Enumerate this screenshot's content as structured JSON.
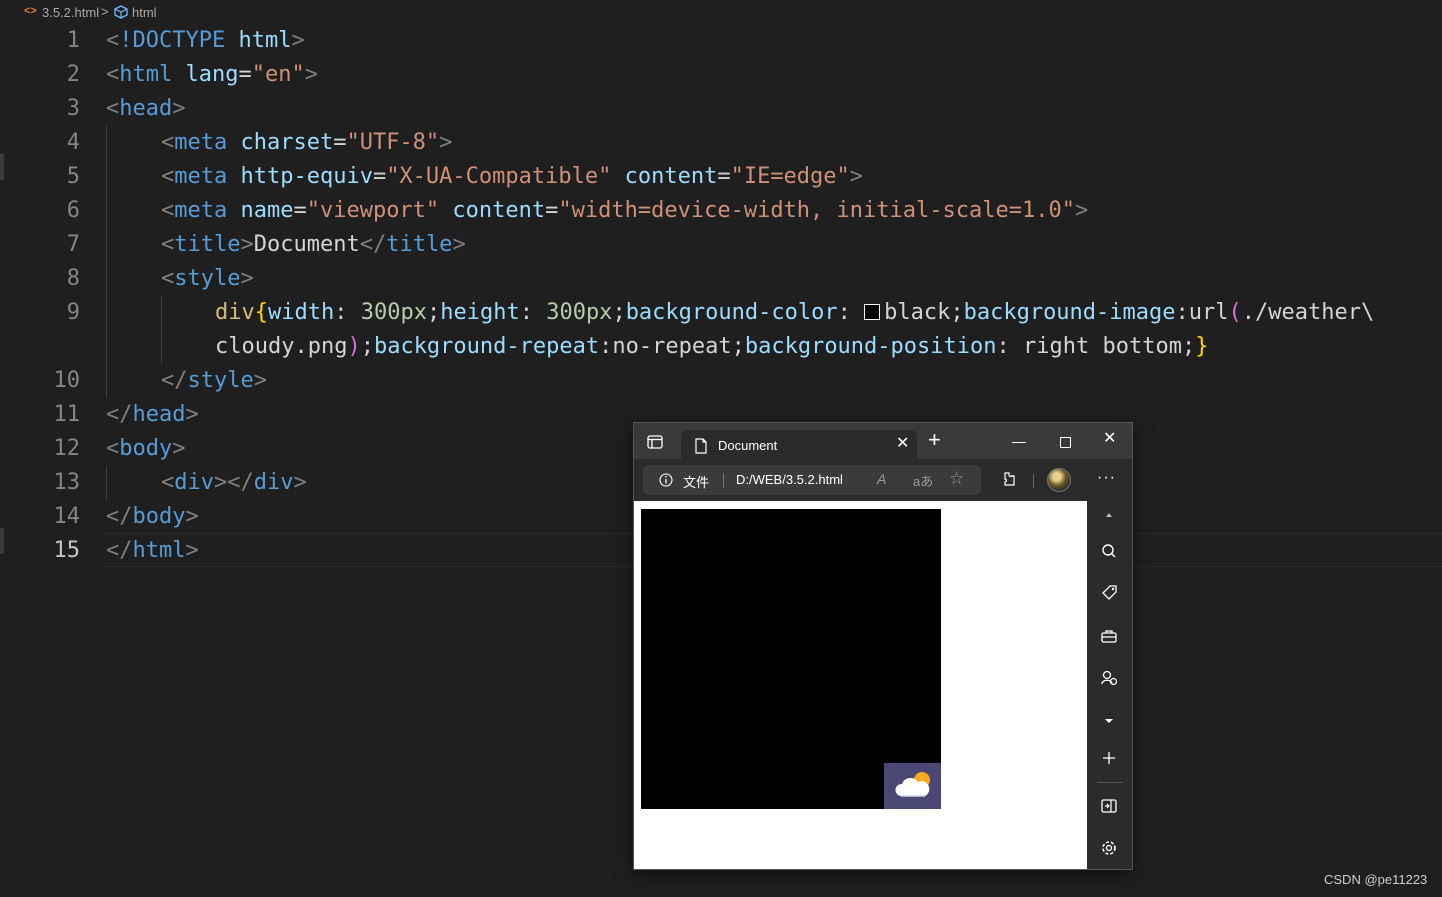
{
  "breadcrumb": {
    "file": "3.5.2.html",
    "separator": ">",
    "node": "html"
  },
  "editor": {
    "line_numbers": [
      "1",
      "2",
      "3",
      "4",
      "5",
      "6",
      "7",
      "8",
      "9",
      "10",
      "11",
      "12",
      "13",
      "14",
      "15"
    ],
    "code": {
      "l1": {
        "open": "<",
        "doctype": "!DOCTYPE",
        "sp": " ",
        "name": "html",
        "close": ">"
      },
      "l2": {
        "open": "<",
        "tag": "html",
        "sp": " ",
        "attr": "lang",
        "eq": "=",
        "val": "\"en\"",
        "close": ">"
      },
      "l3": {
        "open": "<",
        "tag": "head",
        "close": ">"
      },
      "l4": {
        "open": "<",
        "tag": "meta",
        "sp": " ",
        "attr": "charset",
        "eq": "=",
        "val": "\"UTF-8\"",
        "close": ">"
      },
      "l5": {
        "open": "<",
        "tag": "meta",
        "sp": " ",
        "attr1": "http-equiv",
        "eq1": "=",
        "val1": "\"X-UA-Compatible\"",
        "sp2": " ",
        "attr2": "content",
        "eq2": "=",
        "val2": "\"IE=edge\"",
        "close": ">"
      },
      "l6": {
        "open": "<",
        "tag": "meta",
        "sp": " ",
        "attr1": "name",
        "eq1": "=",
        "val1": "\"viewport\"",
        "sp2": " ",
        "attr2": "content",
        "eq2": "=",
        "val2": "\"width=device-width, initial-scale=1.0\"",
        "close": ">"
      },
      "l7": {
        "open": "<",
        "tag": "title",
        "close": ">",
        "text": "Document",
        "open2": "</",
        "tag2": "title",
        "close2": ">"
      },
      "l8": {
        "open": "<",
        "tag": "style",
        "close": ">"
      },
      "l9a": {
        "selector": "div",
        "brace": "{",
        "p1": "width",
        "c1": ": ",
        "v1": "300px",
        "s1": ";",
        "p2": "height",
        "c2": ": ",
        "v2": "300px",
        "s2": ";",
        "p3": "background-color",
        "c3": ": ",
        "v3": "black",
        "s3": ";",
        "p4": "background-image",
        "c4": ":",
        "fn": "url",
        "lparen": "(",
        "path1": "./weather\\"
      },
      "l9b": {
        "path2": "cloudy.png",
        "rparen": ")",
        "s4": ";",
        "p5": "background-repeat",
        "c5": ":",
        "v5": "no-repeat",
        "s5": ";",
        "p6": "background-position",
        "c6": ": ",
        "v6": "right bottom",
        "s6": ";",
        "brace": "}"
      },
      "l10": {
        "open": "</",
        "tag": "style",
        "close": ">"
      },
      "l11": {
        "open": "</",
        "tag": "head",
        "close": ">"
      },
      "l12": {
        "open": "<",
        "tag": "body",
        "close": ">"
      },
      "l13": {
        "open": "<",
        "tag": "div",
        "close": ">",
        "open2": "</",
        "tag2": "div",
        "close2": ">"
      },
      "l14": {
        "open": "</",
        "tag": "body",
        "close": ">"
      },
      "l15": {
        "open": "</",
        "tag": "html",
        "close": ">"
      }
    }
  },
  "browser": {
    "tab_title": "Document",
    "tab_close": "✕",
    "new_tab": "+",
    "window_controls": {
      "minimize": "—",
      "close": "✕"
    },
    "address": {
      "label": "文件",
      "url": "D:/WEB/3.5.2.html"
    },
    "toolbar_icons": {
      "read_aloud": "A",
      "translate": "aあ",
      "favorite": "☆",
      "more": "···"
    },
    "sidebar_icons": [
      "scroll-up-icon",
      "search-icon",
      "tag-icon",
      "toolbox-icon",
      "games-icon",
      "scroll-down-icon",
      "add-icon",
      "hide-sidebar-icon",
      "settings-icon"
    ],
    "page": {
      "div_background": "#000000",
      "image": "cloudy.png",
      "image_position": "right bottom"
    }
  },
  "watermark": "CSDN @pe11223",
  "colors": {
    "editor_bg": "#1f1f1f",
    "tag": "#569cd6",
    "attribute": "#9cdcfe",
    "string": "#ce9178",
    "punctuation": "#808080",
    "selector": "#d7ba7d",
    "number": "#b5cea8",
    "brace": "#ffd700",
    "paren": "#da70d6"
  }
}
